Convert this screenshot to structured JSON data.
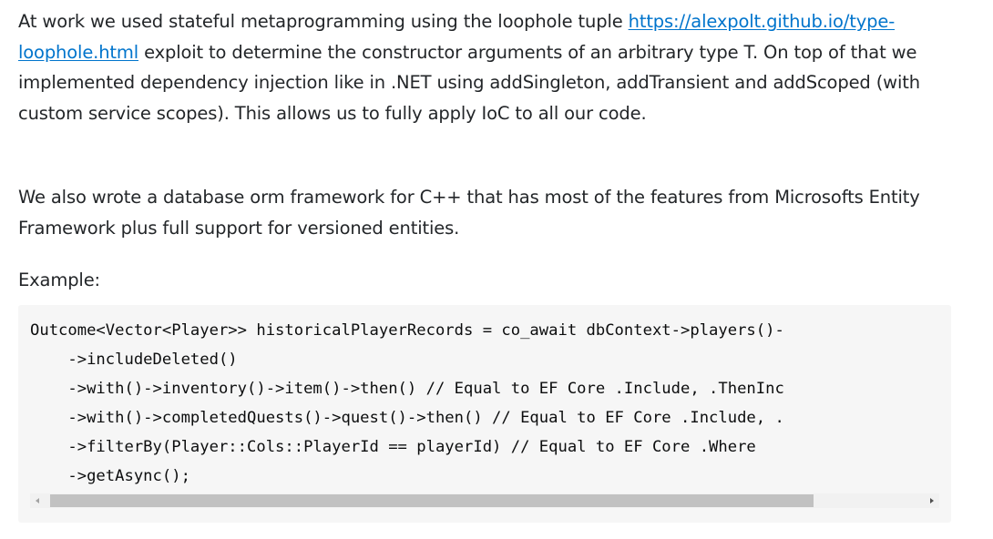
{
  "post": {
    "paragraph1": {
      "before_link": "At work we used stateful metaprogramming using the loophole tuple ",
      "link_text": "https://alexpolt.github.io/type-loophole.html",
      "after_link": " exploit to determine the constructor arguments of an arbitrary type T. On top of that we implemented dependency injection like in .NET using addSingleton, addTransient and addScoped (with custom service scopes). This allows us to fully apply IoC to all our code."
    },
    "paragraph2": "We also wrote a database orm framework for C++ that has most of the features from Microsofts Entity Framework plus full support for versioned entities.",
    "paragraph3": "Example:",
    "code_lines": [
      "Outcome<Vector<Player>> historicalPlayerRecords = co_await dbContext->players()-",
      "    ->includeDeleted()",
      "    ->with()->inventory()->item()->then() // Equal to EF Core .Include, .ThenInc",
      "    ->with()->completedQuests()->quest()->then() // Equal to EF Core .Include, .",
      "    ->filterBy(Player::Cols::PlayerId == playerId) // Equal to EF Core .Where",
      "    ->getAsync();"
    ]
  },
  "colors": {
    "text": "#232629",
    "link": "#0074cc",
    "code_background": "#f6f6f6",
    "scrollbar_thumb": "#c1c1c1"
  },
  "icons": {
    "scroll_left": "triangle-left",
    "scroll_right": "triangle-right"
  }
}
